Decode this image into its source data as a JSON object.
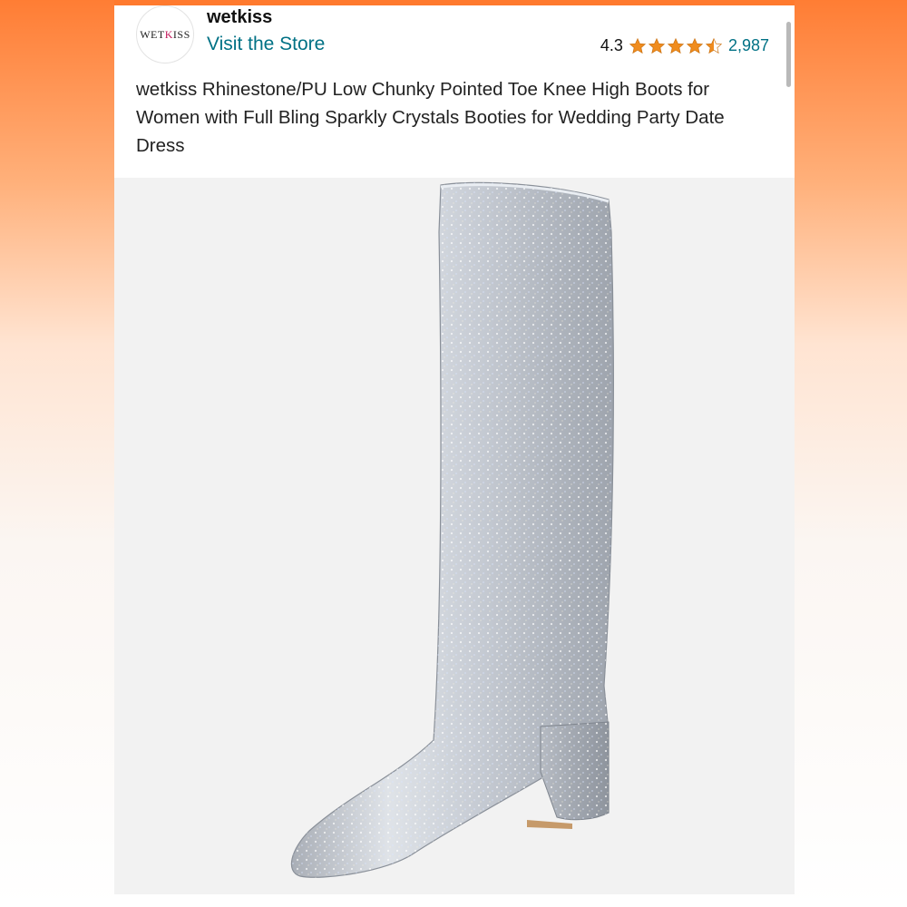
{
  "store": {
    "logo_text": "WETKISS",
    "name": "wetkiss",
    "visit_label": "Visit the Store"
  },
  "rating": {
    "value": "4.3",
    "stars": 4.5,
    "count": "2,987"
  },
  "product": {
    "title": "wetkiss Rhinestone/PU Low Chunky Pointed Toe Knee High Boots for Women with Full Bling Sparkly Crystals Booties for Wedding Party Date Dress",
    "image": "silver-rhinestone-knee-high-boot"
  },
  "colors": {
    "accent_orange": "#ff7a2e",
    "link_teal": "#007185",
    "star_orange": "#f08c1e"
  }
}
